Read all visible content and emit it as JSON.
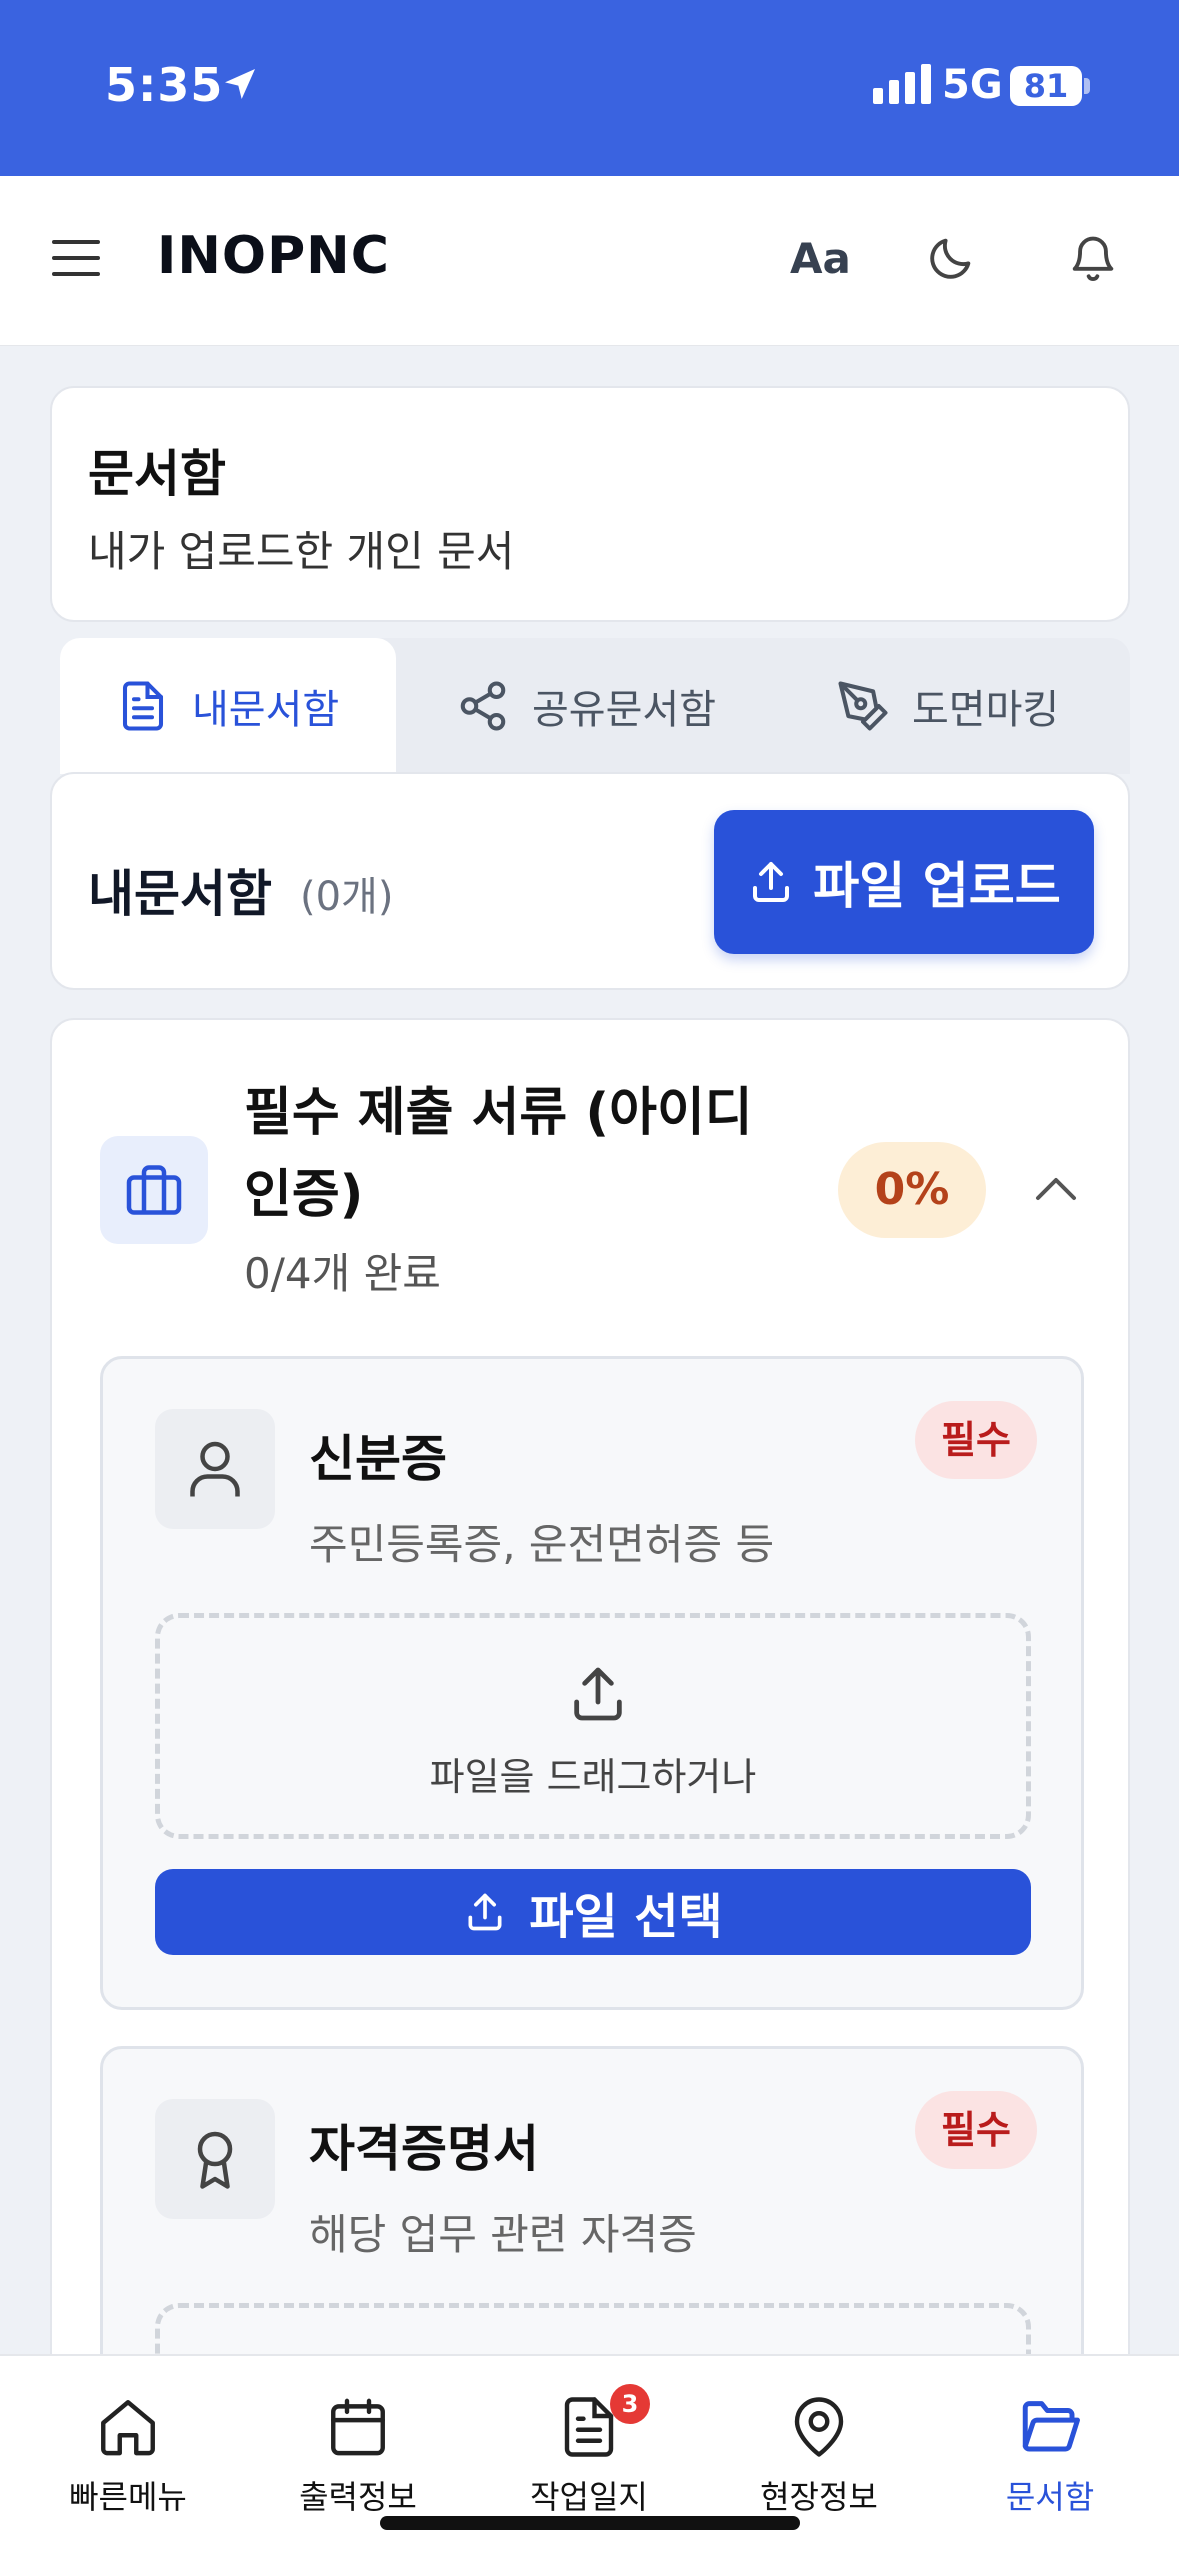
{
  "status_bar": {
    "time": "5:35",
    "network": "5G",
    "battery": "81"
  },
  "header": {
    "brand": "INOPNC",
    "font_button": "Aa"
  },
  "page": {
    "title": "문서함",
    "subtitle": "내가 업로드한 개인 문서"
  },
  "tabs": [
    {
      "label": "내문서함",
      "icon": "document-icon",
      "active": true
    },
    {
      "label": "공유문서함",
      "icon": "share-icon",
      "active": false
    },
    {
      "label": "도면마킹",
      "icon": "pen-tool-icon",
      "active": false
    }
  ],
  "my_docs": {
    "title": "내문서함",
    "count": "(0개)",
    "upload_label": "파일 업로드"
  },
  "required_section": {
    "title": "필수 제출 서류 (아이디 인증)",
    "progress": "0/4개 완료",
    "percent": "0%",
    "items": [
      {
        "title": "신분증",
        "description": "주민등록증, 운전면허증 등",
        "badge": "필수",
        "drop_text": "파일을 드래그하거나",
        "select_label": "파일 선택",
        "icon": "user-icon"
      },
      {
        "title": "자격증명서",
        "description": "해당 업무 관련 자격증",
        "badge": "필수",
        "icon": "award-icon"
      }
    ]
  },
  "bottom_nav": [
    {
      "label": "빠른메뉴",
      "icon": "home-icon"
    },
    {
      "label": "출력정보",
      "icon": "calendar-icon"
    },
    {
      "label": "작업일지",
      "icon": "document-icon",
      "badge": "3"
    },
    {
      "label": "현장정보",
      "icon": "map-pin-icon"
    },
    {
      "label": "문서함",
      "icon": "folder-open-icon",
      "active": true
    }
  ],
  "colors": {
    "primary": "#2952d9",
    "status_bar": "#3a63e0",
    "required_badge": "#b91c1c",
    "percent_badge_bg": "#fdeed6"
  }
}
